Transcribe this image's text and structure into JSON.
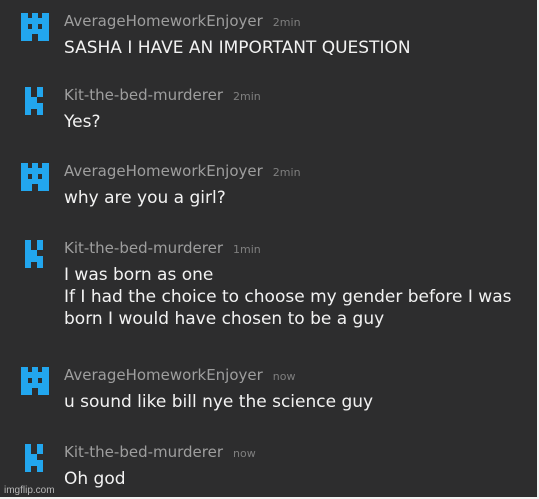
{
  "messages": [
    {
      "user": "AverageHomeworkEnjoyer",
      "time": "2min",
      "avatar": "castle-icon",
      "lines": [
        "SASHA I HAVE AN IMPORTANT QUESTION"
      ]
    },
    {
      "user": "Kit-the-bed-murderer",
      "time": "2min",
      "avatar": "letter-k-icon",
      "lines": [
        "Yes?"
      ]
    },
    {
      "user": "AverageHomeworkEnjoyer",
      "time": "2min",
      "avatar": "castle-icon",
      "lines": [
        "why are you a girl?"
      ]
    },
    {
      "user": "Kit-the-bed-murderer",
      "time": "1min",
      "avatar": "letter-k-icon",
      "lines": [
        "I was born as one",
        "If I had the choice to choose my gender before I was",
        "born I would have chosen to be a guy"
      ]
    },
    {
      "user": "AverageHomeworkEnjoyer",
      "time": "now",
      "avatar": "castle-icon",
      "lines": [
        "u sound like bill nye the science guy"
      ]
    },
    {
      "user": "Kit-the-bed-murderer",
      "time": "now",
      "avatar": "letter-k-icon",
      "lines": [
        "Oh god"
      ]
    }
  ],
  "watermark": "imgflip.com",
  "colors": {
    "background": "#2d2d2e",
    "avatar_blue": "#22a6ee",
    "username": "#9e9e9e",
    "message_text": "#f2f2f2"
  }
}
